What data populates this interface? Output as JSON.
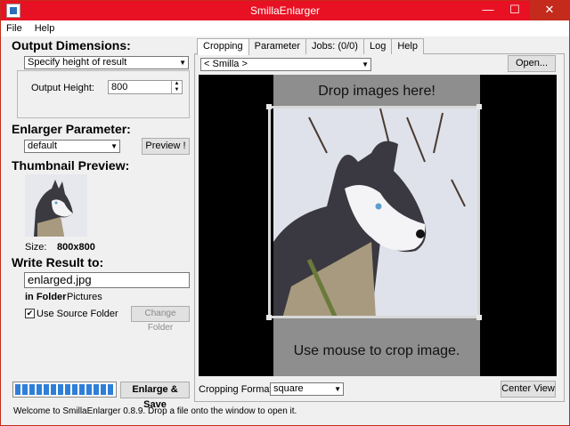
{
  "window": {
    "title": "SmillaEnlarger",
    "minimize": "—",
    "maximize": "☐",
    "close": "✕"
  },
  "menu": {
    "file": "File",
    "help": "Help"
  },
  "output": {
    "header": "Output Dimensions:",
    "mode": "Specify height of result",
    "height_label": "Output Height:",
    "height_value": "800"
  },
  "enlarger": {
    "header": "Enlarger Parameter:",
    "preset": "default",
    "preview_button": "Preview !"
  },
  "thumbnail": {
    "header": "Thumbnail Preview:",
    "size_label": "Size:",
    "size_value": "800x800"
  },
  "result": {
    "header": "Write Result to:",
    "filename": "enlarged.jpg",
    "folder_label": "in Folder",
    "folder_value": "Pictures",
    "use_source_label": "Use Source Folder",
    "use_source_checked": true,
    "change_folder_button": "Change Folder"
  },
  "progress": {
    "fraction": 1.0
  },
  "enlarge_button": "Enlarge & Save",
  "tabs": [
    "Cropping",
    "Parameter",
    "Jobs: (0/0)",
    "Log",
    "Help"
  ],
  "cropping": {
    "source_select": "< Smilla >",
    "open_button": "Open...",
    "drop_text": "Drop images here!",
    "crop_text": "Use mouse to crop image.",
    "format_label": "Cropping Format:",
    "format_value": "square",
    "center_view_button": "Center View"
  },
  "status": "Welcome to SmillaEnlarger 0.8.9.  Drop a file onto the window to open it.",
  "colors": {
    "titlebar": "#e81123",
    "progress": "#2f7fd8",
    "viewport_bg": "#000000",
    "dropzone": "#8e8e8e"
  }
}
